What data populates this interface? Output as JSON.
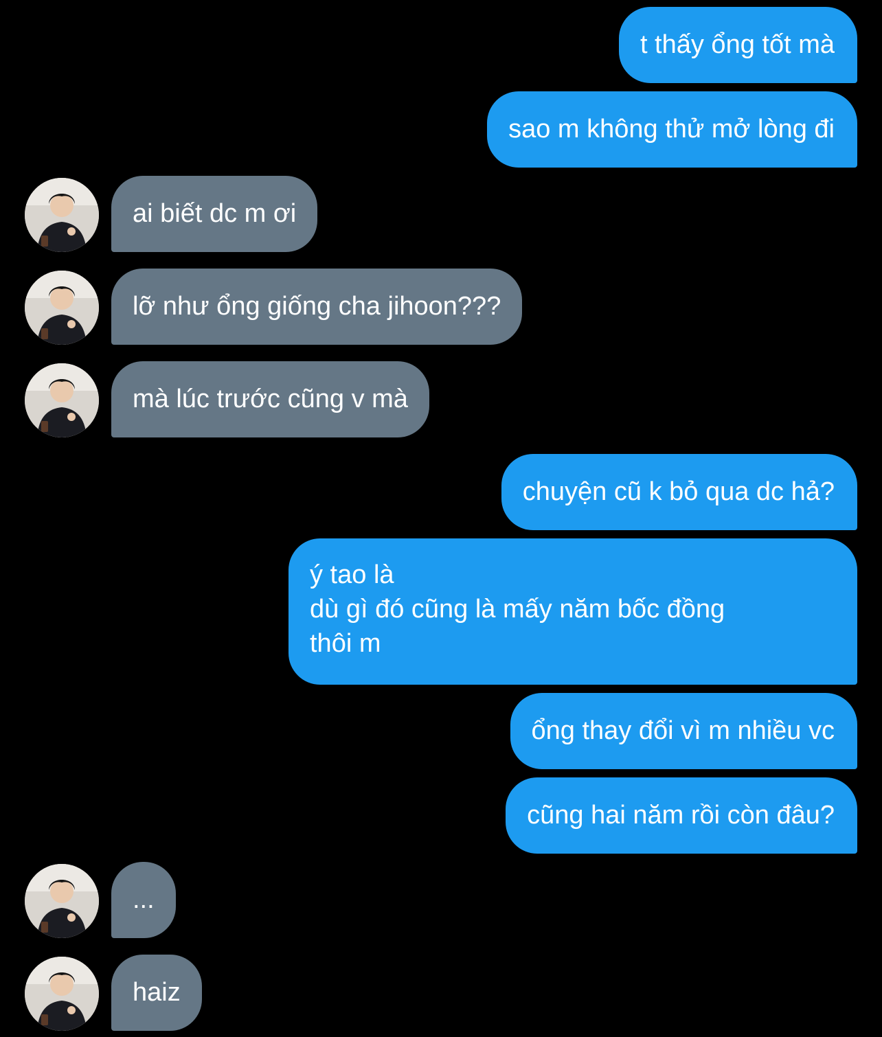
{
  "conversation": {
    "messages": [
      {
        "sender": "me",
        "text": "t thấy ổng tốt mà"
      },
      {
        "sender": "me",
        "text": "sao m không thử mở lòng đi"
      },
      {
        "sender": "other",
        "text": "ai biết dc m ơi"
      },
      {
        "sender": "other",
        "text": "lỡ như ổng giống cha jihoon???"
      },
      {
        "sender": "other",
        "text": "mà lúc trước cũng v mà"
      },
      {
        "sender": "me",
        "text": "chuyện cũ k bỏ qua dc hả?"
      },
      {
        "sender": "me",
        "text": "ý tao là\ndù gì đó cũng là mấy năm bốc đồng\nthôi m"
      },
      {
        "sender": "me",
        "text": "ổng thay đổi vì m nhiều vc"
      },
      {
        "sender": "me",
        "text": "cũng hai năm rồi còn đâu?"
      },
      {
        "sender": "other",
        "text": "..."
      },
      {
        "sender": "other",
        "text": "haiz"
      }
    ]
  },
  "colors": {
    "background": "#000000",
    "sent_bubble": "#1d9bf0",
    "received_bubble": "#657786",
    "text": "#ffffff"
  },
  "icons": {
    "avatar": "profile-photo-icon"
  }
}
